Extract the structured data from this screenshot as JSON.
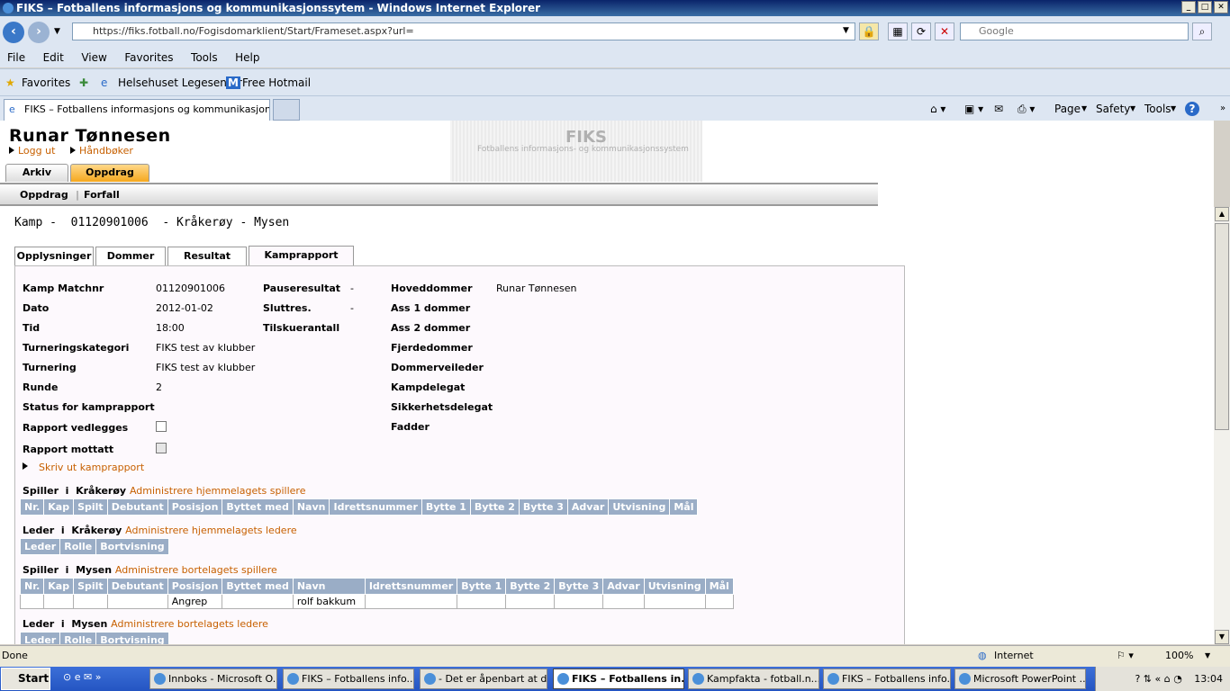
{
  "window": {
    "title": "FIKS – Fotballens informasjons og kommunikasjonssytem - Windows Internet Explorer"
  },
  "browser": {
    "url": "https://fiks.fotball.no/Fogisdomarklient/Start/Frameset.aspx?url=",
    "search_placeholder": "Google",
    "menu": [
      "File",
      "Edit",
      "View",
      "Favorites",
      "Tools",
      "Help"
    ],
    "favorites_label": "Favorites",
    "favorites": [
      "Helsehuset Legesenter",
      "Free Hotmail"
    ],
    "tab_title": "FIKS – Fotballens informasjons og kommunikasjonssytem",
    "commands": {
      "page": "Page",
      "safety": "Safety",
      "tools": "Tools"
    }
  },
  "page": {
    "user_name": "Runar Tønnesen",
    "logout": "Logg ut",
    "handbooks": "Håndbøker",
    "logo_title": "FIKS",
    "logo_subtitle": "Fotballens informasjons- og kommunikasjonssystem",
    "main_tabs": [
      "Arkiv",
      "Oppdrag"
    ],
    "sub_nav": [
      "Oppdrag",
      "Forfall"
    ],
    "match_title": "Kamp -  01120901006  - Kråkerøy - Mysen",
    "content_tabs": [
      "Opplysninger",
      "Dommer",
      "Resultat",
      "Kamprapport"
    ],
    "fields": {
      "matchnr_label": "Kamp Matchnr",
      "matchnr": "01120901006",
      "dato_label": "Dato",
      "dato": "2012-01-02",
      "tid_label": "Tid",
      "tid": "18:00",
      "turneringskategori_label": "Turneringskategori",
      "turneringskategori": "FIKS test av klubber",
      "turnering_label": "Turnering",
      "turnering": "FIKS test av klubber",
      "runde_label": "Runde",
      "runde": "2",
      "status_label": "Status for kamprapport",
      "rapport_vedlegges_label": "Rapport vedlegges",
      "rapport_mottatt_label": "Rapport mottatt",
      "pause_label": "Pauseresultat",
      "pause": "-",
      "slutt_label": "Sluttres.",
      "slutt": "-",
      "tilskuer_label": "Tilskuerantall",
      "hoveddommer_label": "Hoveddommer",
      "hoveddommer": "Runar Tønnesen",
      "ass1_label": "Ass 1 dommer",
      "ass2_label": "Ass 2 dommer",
      "fjerde_label": "Fjerdedommer",
      "veileder_label": "Dommerveileder",
      "kampdelegat_label": "Kampdelegat",
      "sikkerhet_label": "Sikkerhetsdelegat",
      "fadder_label": "Fadder"
    },
    "print_link": "Skriv ut kamprapport",
    "home_players": {
      "title": "Spiller  i  Kråkerøy",
      "link": "Administrere hjemmelagets spillere"
    },
    "home_leaders": {
      "title": "Leder  i  Kråkerøy",
      "link": "Administrere hjemmelagets ledere"
    },
    "away_players": {
      "title": "Spiller  i  Mysen",
      "link": "Administrere bortelagets spillere"
    },
    "away_leaders": {
      "title": "Leder  i  Mysen",
      "link": "Administrere bortelagets ledere"
    },
    "player_columns": [
      "Nr.",
      "Kap",
      "Spilt",
      "Debutant",
      "Posisjon",
      "Byttet med",
      "Navn",
      "Idrettsnummer",
      "Bytte 1",
      "Bytte 2",
      "Bytte 3",
      "Advar",
      "Utvisning",
      "Mål"
    ],
    "leader_columns": [
      "Leder",
      "Rolle",
      "Bortvisning"
    ],
    "away_row": [
      "",
      "",
      "",
      "",
      "Angrep",
      "",
      "rolf bakkum",
      "",
      "",
      "",
      "",
      "",
      "",
      ""
    ]
  },
  "status": {
    "left": "Done",
    "zone": "Internet",
    "zoom": "100%"
  },
  "taskbar": {
    "start": "Start",
    "items": [
      "Innboks - Microsoft O...",
      "FIKS – Fotballens info...",
      "- Det er åpenbart at d...",
      "FIKS – Fotballens in...",
      "Kampfakta - fotball.n...",
      "FIKS – Fotballens info...",
      "Microsoft PowerPoint ..."
    ],
    "clock": "13:04"
  }
}
